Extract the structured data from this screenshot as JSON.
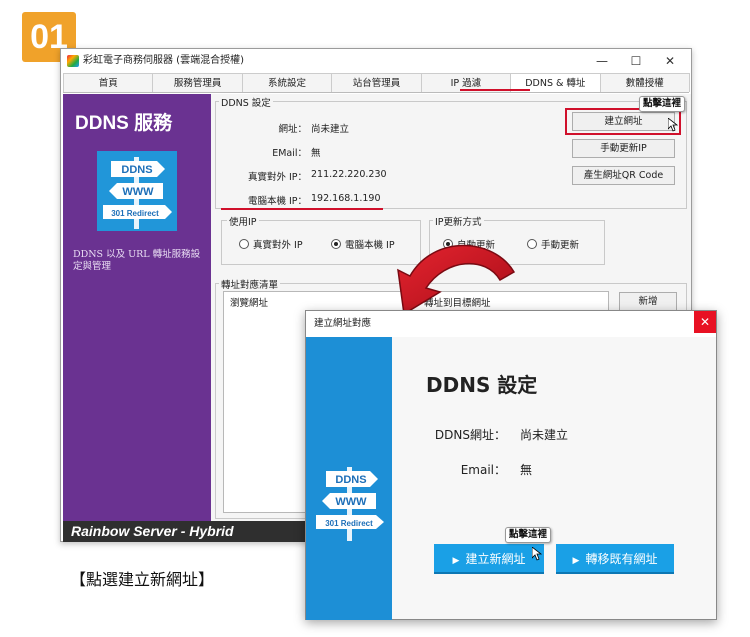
{
  "step_number": "01",
  "window": {
    "title": "彩虹電子商務伺服器 (雲端混合授權)",
    "controls": {
      "minimize": "—",
      "maximize": "☐",
      "close": "✕"
    },
    "tabs": [
      "首頁",
      "服務管理員",
      "系統設定",
      "站台管理員",
      "IP 過濾",
      "DDNS & 轉址",
      "數體授權"
    ],
    "active_tab": "DDNS & 轉址"
  },
  "sidebar": {
    "title": "DDNS 服務",
    "logo_signs": [
      "DDNS",
      "WWW",
      "301 Redirect"
    ],
    "description": "DDNS 以及 URL 轉址服務設定與管理",
    "footer": "Rainbow Server - Hybrid"
  },
  "ddns_settings": {
    "group_label": "DDNS 設定",
    "fields": [
      {
        "label": "網址：",
        "value": "尚未建立"
      },
      {
        "label": "EMail：",
        "value": "無"
      },
      {
        "label": "真實對外 IP：",
        "value": "211.22.220.230"
      },
      {
        "label": "電腦本機 IP：",
        "value": "192.168.1.190"
      }
    ],
    "buttons": {
      "create": "建立網址",
      "manual_update": "手動更新IP",
      "qr": "產生網址QR Code"
    },
    "use_ip": {
      "label": "使用IP",
      "options": [
        "真實對外 IP",
        "電腦本機 IP"
      ],
      "selected": "電腦本機 IP"
    },
    "update_mode": {
      "label": "IP更新方式",
      "options": [
        "自動更新",
        "手動更新"
      ],
      "selected": "自動更新"
    }
  },
  "redirect_list": {
    "label": "轉址對應清單",
    "columns": [
      "瀏覽網址",
      "轉址到目標網址"
    ],
    "add_button": "新增"
  },
  "click_here": "點擊這裡",
  "caption": "【點選建立新網址】",
  "dialog": {
    "title": "建立網址對應",
    "close": "✕",
    "heading": "DDNS 設定",
    "fields": [
      {
        "label": "DDNS網址：",
        "value": "尚未建立"
      },
      {
        "label": "Email：",
        "value": "無"
      }
    ],
    "buttons": {
      "create_new": "建立新網址",
      "transfer": "轉移既有網址"
    },
    "button_glyph": "▶"
  },
  "colors": {
    "accent_red": "#d0102b",
    "purple": "#6a3291",
    "blue": "#1d8fd6",
    "badge_orange": "#f0a22a"
  }
}
